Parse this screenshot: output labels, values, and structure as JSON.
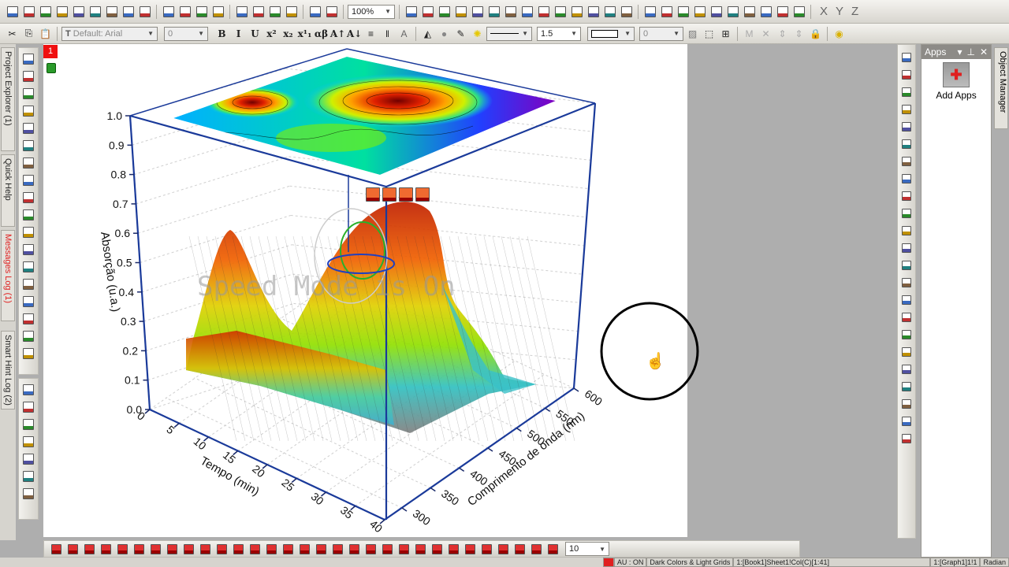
{
  "toolbar1": {
    "icons_a": [
      "new-project-icon",
      "new-folder-icon",
      "new-workbook-icon",
      "new-graph-icon",
      "new-matrix-icon",
      "new-function-icon",
      "new-layout-icon",
      "new-notes-icon",
      "new-excel-icon"
    ],
    "icons_b": [
      "open-icon",
      "open-template-icon",
      "save-project-icon",
      "save-template-icon"
    ],
    "icons_c": [
      "import-wizard-icon",
      "import-ascii-icon",
      "import-multiple-ascii-icon",
      "import-excel-icon"
    ],
    "icons_d": [
      "duplicate-icon",
      "speed-mode-icon"
    ],
    "zoom_value": "100%",
    "icons_e": [
      "print-icon",
      "slideshow-icon",
      "export-icon",
      "movie-icon",
      "refresh-icon",
      "add-layer-icon",
      "arrange-layers-icon",
      "hierarchy-icon",
      "find-icon",
      "zoom-data-icon",
      "results-log-icon",
      "code-builder-icon",
      "apps-gear-icon",
      "add-column-icon"
    ],
    "icons_f": [
      "column-statistics-icon",
      "sum-icon",
      "sort-icon",
      "set-values-icon",
      "bar-chart-icon",
      "column-chart-icon",
      "histogram-icon",
      "filter-icon",
      "remove-filter-icon",
      "reapply-filter-icon"
    ],
    "axis_labels": [
      "X",
      "Y",
      "Z"
    ]
  },
  "toolbar2": {
    "font_name": "Default: Arial",
    "font_size": "0",
    "format_labels": [
      "B",
      "I",
      "U",
      "x²",
      "x₂",
      "x¹₁",
      "αβ",
      "A↑",
      "A↓"
    ],
    "line_width": "1.5",
    "pattern_value": "0"
  },
  "left_tabs": [
    "Project Explorer (1)",
    "Quick Help",
    "Messages Log (1)",
    "Smart Hint Log (2)"
  ],
  "left_tools": [
    "pointer-icon",
    "zoom-in-icon",
    "zoom-out-icon",
    "data-reader-icon",
    "screen-reader-icon",
    "data-selector-icon",
    "mask-icon",
    "draw-data-icon",
    "scatter-points-icon",
    "text-tool-icon",
    "arrow-tool-icon",
    "line-tool-icon",
    "rectangle-tool-icon",
    "hand-icon",
    "equation-icon",
    "insert-graph-icon",
    "rotate-hand-icon",
    "object-3d-icon"
  ],
  "left_tools2": [
    "color-palette-icon",
    "spiral-icon",
    "sparkle-icon",
    "workbook-icon",
    "target-icon",
    "layers-icon",
    "table-icon"
  ],
  "graph": {
    "layer_number": "1",
    "watermark": "Speed Mode is On",
    "floating_tools": [
      "move-icon",
      "resize-icon",
      "rotate-icon",
      "pin-icon"
    ]
  },
  "chart_data": {
    "type": "surface3d",
    "title": "",
    "xlabel": "Tempo (min)",
    "ylabel": "Comprimento de onda (nm)",
    "zlabel": "Absorção (u.a.)",
    "x_ticks": [
      "0",
      "5",
      "10",
      "15",
      "20",
      "25",
      "30",
      "35",
      "40"
    ],
    "y_ticks": [
      "300",
      "350",
      "400",
      "450",
      "500",
      "550",
      "600"
    ],
    "z_ticks": [
      "0.0",
      "0.1",
      "0.2",
      "0.3",
      "0.4",
      "0.5",
      "0.6",
      "0.7",
      "0.8",
      "0.9",
      "1.0"
    ],
    "xlim": [
      0,
      40
    ],
    "ylim": [
      300,
      600
    ],
    "zlim": [
      0,
      1
    ],
    "colormap": [
      "#7a00c8",
      "#0040ff",
      "#00c8ff",
      "#30e0a0",
      "#a0f000",
      "#f0e000",
      "#ff8000",
      "#e02000",
      "#800000"
    ],
    "projection_contour_on_top": true
  },
  "right_tools": [
    "layer-icon",
    "axis-icon",
    "swap-xy-icon",
    "speed-mode-icon",
    "layer-settings-icon",
    "merge-icon",
    "arrange-icon",
    "grid-icon",
    "extract-icon",
    "align-left-icon",
    "align-right-icon",
    "align-top-icon",
    "align-bottom-icon",
    "resize-icon",
    "distribute-icon",
    "same-width-icon",
    "same-height-icon",
    "group-icon",
    "ungroup-icon",
    "front-icon",
    "back-icon",
    "forward-icon",
    "backward-icon"
  ],
  "apps": {
    "title": "Apps",
    "add_apps_label": "Add Apps"
  },
  "object_manager_tab": "Object Manager",
  "bottom_toolbar": {
    "icons": [
      "line-plot-icon",
      "scatter-plot-icon",
      "line-symbol-icon",
      "column-plot-icon",
      "box-chart-icon",
      "stacked-icon",
      "area-plot-icon",
      "polar-icon",
      "contour-icon",
      "3d-surface-icon",
      "3d-bar-icon",
      "3d-wire-icon",
      "3d-scatter-icon",
      "matrix-icon",
      "template-icon",
      "image-icon",
      "stats-icon",
      "map-icon",
      "ternary-icon",
      "piper-icon",
      "rotate-left-icon",
      "rotate-right-icon",
      "tilt-left-icon",
      "tilt-right-icon",
      "increase-perspective-icon",
      "decrease-perspective-icon",
      "enlarge-icon",
      "shrink-icon",
      "fit-frame-icon",
      "reset-icon",
      "rotate-3d-icon"
    ],
    "rotation_step": "10"
  },
  "status": {
    "fields": [
      "AU : ON",
      "Dark Colors & Light Grids",
      "1:[Book1]Sheet1!Col(C)[1:41]",
      "1:[Graph1]1!1",
      "Radian"
    ]
  }
}
